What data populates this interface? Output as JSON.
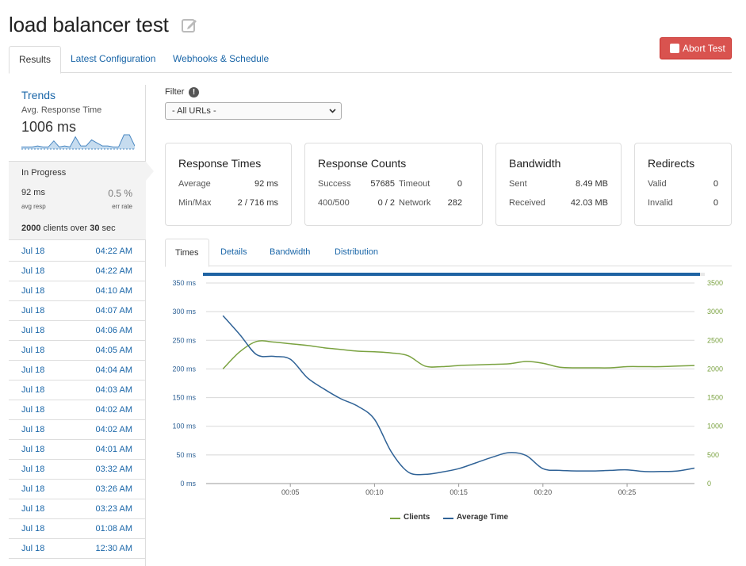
{
  "header": {
    "title": "load balancer test"
  },
  "tabs": [
    {
      "label": "Results",
      "active": true
    },
    {
      "label": "Latest Configuration",
      "active": false
    },
    {
      "label": "Webhooks & Schedule",
      "active": false
    }
  ],
  "abort_label": "Abort Test",
  "sidebar": {
    "trends_title": "Trends",
    "trends_sub": "Avg. Response Time",
    "trends_value": "1006 ms",
    "sparkline": [
      2,
      2,
      2,
      3,
      2,
      2,
      8,
      2,
      3,
      2,
      12,
      3,
      3,
      9,
      6,
      3,
      3,
      2,
      2,
      14,
      14,
      3
    ],
    "progress_title": "In Progress",
    "avg_resp_value": "92 ms",
    "avg_resp_label": "avg resp",
    "err_rate_value": "0.5 %",
    "err_rate_label": "err rate",
    "clients_count": "2000",
    "clients_mid": " clients over ",
    "clients_duration": "30",
    "clients_unit": " sec",
    "runs": [
      {
        "date": "Jul 18",
        "time": "04:22 AM"
      },
      {
        "date": "Jul 18",
        "time": "04:22 AM"
      },
      {
        "date": "Jul 18",
        "time": "04:10 AM"
      },
      {
        "date": "Jul 18",
        "time": "04:07 AM"
      },
      {
        "date": "Jul 18",
        "time": "04:06 AM"
      },
      {
        "date": "Jul 18",
        "time": "04:05 AM"
      },
      {
        "date": "Jul 18",
        "time": "04:04 AM"
      },
      {
        "date": "Jul 18",
        "time": "04:03 AM"
      },
      {
        "date": "Jul 18",
        "time": "04:02 AM"
      },
      {
        "date": "Jul 18",
        "time": "04:02 AM"
      },
      {
        "date": "Jul 18",
        "time": "04:01 AM"
      },
      {
        "date": "Jul 18",
        "time": "03:32 AM"
      },
      {
        "date": "Jul 18",
        "time": "03:26 AM"
      },
      {
        "date": "Jul 18",
        "time": "03:23 AM"
      },
      {
        "date": "Jul 18",
        "time": "01:08 AM"
      },
      {
        "date": "Jul 18",
        "time": "12:30 AM"
      }
    ]
  },
  "filter": {
    "label": "Filter",
    "info": "!",
    "selected": "- All URLs -"
  },
  "cards": {
    "response_times": {
      "title": "Response Times",
      "average_label": "Average",
      "average_value": "92 ms",
      "minmax_label": "Min/Max",
      "minmax_value": "2 / 716 ms"
    },
    "response_counts": {
      "title": "Response Counts",
      "success_label": "Success",
      "success_value": "57685",
      "timeout_label": "Timeout",
      "timeout_value": "0",
      "code_label": "400/500",
      "code_value": "0 / 2",
      "network_label": "Network",
      "network_value": "282"
    },
    "bandwidth": {
      "title": "Bandwidth",
      "sent_label": "Sent",
      "sent_value": "8.49 MB",
      "received_label": "Received",
      "received_value": "42.03 MB"
    },
    "redirects": {
      "title": "Redirects",
      "valid_label": "Valid",
      "valid_value": "0",
      "invalid_label": "Invalid",
      "invalid_value": "0"
    }
  },
  "sub_tabs": [
    {
      "label": "Times",
      "active": true
    },
    {
      "label": "Details",
      "active": false
    },
    {
      "label": "Bandwidth",
      "active": false
    },
    {
      "label": "Distribution",
      "active": false
    }
  ],
  "test_progress": 0.99,
  "colors": {
    "link": "#1a66a8",
    "clients": "#7aa240",
    "avg_time": "#2f6296",
    "danger": "#d9534f"
  },
  "chart_data": {
    "type": "line",
    "x_unit_seconds": true,
    "x_ticks": [
      "00:05",
      "00:10",
      "00:15",
      "00:20",
      "00:25"
    ],
    "x_tick_values": [
      5,
      10,
      15,
      20,
      25
    ],
    "xlim": [
      0,
      29
    ],
    "y_left_ticks": [
      "0 ms",
      "50 ms",
      "100 ms",
      "150 ms",
      "200 ms",
      "250 ms",
      "300 ms",
      "350 ms"
    ],
    "y_left_lim": [
      0,
      350
    ],
    "y_right_ticks": [
      "0",
      "500",
      "1000",
      "1500",
      "2000",
      "2500",
      "3000",
      "3500"
    ],
    "y_right_lim": [
      0,
      3500
    ],
    "legend_position": "bottom",
    "series": [
      {
        "name": "Clients",
        "axis": "right",
        "color": "#7aa240",
        "x": [
          1,
          2,
          3,
          4,
          5,
          6,
          7,
          8,
          9,
          10,
          11,
          12,
          13,
          14,
          15,
          16,
          17,
          18,
          19,
          20,
          21,
          22,
          23,
          24,
          25,
          26,
          27,
          28,
          29
        ],
        "values": [
          2000,
          2300,
          2480,
          2470,
          2440,
          2410,
          2370,
          2340,
          2310,
          2300,
          2280,
          2230,
          2050,
          2040,
          2060,
          2070,
          2080,
          2090,
          2130,
          2100,
          2030,
          2020,
          2020,
          2020,
          2040,
          2040,
          2040,
          2050,
          2060
        ]
      },
      {
        "name": "Average Time",
        "axis": "left",
        "color": "#2f6296",
        "x": [
          1,
          2,
          3,
          4,
          5,
          6,
          7,
          8,
          9,
          10,
          11,
          12,
          13,
          14,
          15,
          16,
          17,
          18,
          19,
          20,
          21,
          22,
          23,
          24,
          25,
          26,
          27,
          28,
          29
        ],
        "values": [
          293,
          260,
          225,
          222,
          217,
          185,
          165,
          148,
          135,
          112,
          55,
          20,
          16,
          20,
          26,
          36,
          46,
          54,
          49,
          26,
          23,
          22,
          22,
          23,
          24,
          21,
          21,
          22,
          27
        ]
      }
    ]
  }
}
